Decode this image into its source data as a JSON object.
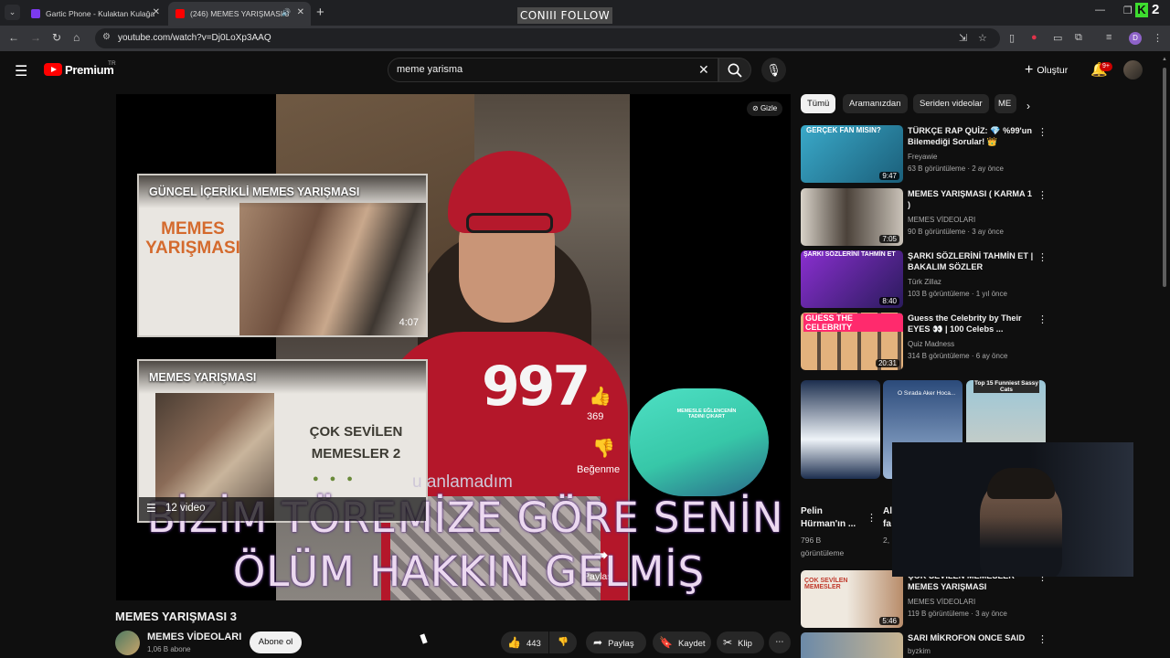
{
  "browser": {
    "tabs": [
      {
        "title": "Gartic Phone - Kulaktan Kulağa",
        "favicon_color": "#7c3aed"
      },
      {
        "title": "(246) MEMES YARIŞMASI 3",
        "favicon_color": "#ff0000"
      }
    ],
    "url": "youtube.com/watch?v=Dj0LoXp3AAQ",
    "profile_initial": "D",
    "icons": {
      "tab_menu": "chevron-down-icon",
      "close": "close-icon",
      "new_tab": "plus-icon",
      "speaker": "speaker-icon",
      "back": "arrow-left-icon",
      "forward": "arrow-right-icon",
      "reload": "reload-icon",
      "home": "home-icon",
      "site_info": "tune-icon",
      "install": "install-app-icon",
      "bookmark_star": "star-icon"
    }
  },
  "stream_overlay": {
    "banner": "CONIII FOLLOW",
    "kick_letter": "K",
    "kick_viewers": "2"
  },
  "youtube": {
    "logo_text": "Premium",
    "country_code": "TR",
    "search_query": "meme yarisma",
    "create_label": "Oluştur",
    "notification_badge": "9+",
    "brand_color": "#ff0000"
  },
  "player": {
    "hide_chip": "Gizle",
    "cards": [
      {
        "title": "GÜNCEL İÇERİKLİ MEMES YARIŞMASI",
        "thumb_text": "MEMES YARIŞMASI",
        "duration": "4:07"
      },
      {
        "title": "MEMES YARIŞMASI",
        "thumb_text": "ÇOK SEVİLEN MEMESLER 2",
        "playlist_count": "12 video"
      }
    ],
    "shirt_number": "997",
    "like_count": "369",
    "dislike_label": "Beğenme",
    "share_label": "Paylaş",
    "promo_text": "MEMESLE EĞLENCENİN TADINI ÇIKART",
    "subtitle_small": "u anlamadım",
    "subtitle_line1": "BİZİM TÖREMİZE GÖRE SENİN",
    "subtitle_line2": "ÖLÜM HAKKIN GELMİŞ"
  },
  "video": {
    "title": "MEMES YARIŞMASI 3",
    "channel": "MEMES VİDEOLARI",
    "subscribers": "1,06 B abone",
    "subscribe_label": "Abone ol",
    "like_count": "443",
    "share_label": "Paylaş",
    "save_label": "Kaydet",
    "clip_label": "Klip"
  },
  "sidebar": {
    "chips": [
      "Tümü",
      "Aramanızdan",
      "Seriden videolar",
      "ME"
    ],
    "recommendations": [
      {
        "title": "TÜRKÇE RAP QUİZ: 💎 %99'un Bilemediği Sorular! 👑",
        "channel": "Freyawie",
        "meta": "63 B görüntüleme · 2 ay önce",
        "duration": "9:47",
        "thumb_text": "GERÇEK FAN MISIN?",
        "thumb_colors": [
          "#3aa9c9",
          "#1b5f7a"
        ]
      },
      {
        "title": "MEMES YARIŞMASI ( KARMA 1 )",
        "channel": "MEMES VİDEOLARI",
        "meta": "90 B görüntüleme · 3 ay önce",
        "duration": "7:05",
        "thumb_text": "",
        "thumb_colors": [
          "#d8d2c8",
          "#4b423a"
        ]
      },
      {
        "title": "ŞARKI SÖZLERİNİ TAHMİN ET | BAKALIM SÖZLER HAFIZAND...",
        "channel": "Türk Zillaz",
        "meta": "103 B görüntüleme · 1 yıl önce",
        "duration": "8:40",
        "thumb_text": "ŞARKI SÖZLERİNİ TAHMİN ET",
        "thumb_colors": [
          "#8a2fd0",
          "#2a1b5c"
        ]
      },
      {
        "title": "Guess the Celebrity by Their EYES 👀 | 100 Celebs ...",
        "channel": "Quiz Madness",
        "meta": "314 B görüntüleme · 6 ay önce",
        "duration": "20:31",
        "thumb_text": "GUESS THE CELEBRITY",
        "thumb_colors": [
          "#e3b27d",
          "#5c4a3c"
        ]
      },
      {
        "title": "ÇOK SEVİLEN MEMESLER MEMES YARIŞMASI",
        "channel": "MEMES VİDEOLARI",
        "meta": "119 B görüntüleme · 3 ay önce",
        "duration": "5:46",
        "thumb_text": "ÇOK SEVİLEN MEMESLER",
        "thumb_colors": [
          "#efe9df",
          "#b88c6a"
        ]
      },
      {
        "title": "SARI MİKROFON ONCE SAID",
        "channel": "byzkim",
        "meta": "",
        "duration": "",
        "thumb_text": "",
        "thumb_colors": [
          "#6c8aa8",
          "#c8b592"
        ]
      }
    ],
    "shorts": [
      {
        "title": "Pelin Hürman'ın ...",
        "meta": "796 B görüntüleme",
        "overlay": "",
        "colors": [
          "#1d2f4f",
          "#eef3f8"
        ]
      },
      {
        "title": "Al fa",
        "meta": "2,",
        "overlay": "O Sırada Aker Hoca...",
        "colors": [
          "#2b4a7a",
          "#9fb8d8"
        ]
      },
      {
        "title": "",
        "meta": "",
        "overlay": "Top 15 Funniest Sassy Cats",
        "colors": [
          "#9bc7d8",
          "#d9cfc0"
        ]
      }
    ]
  }
}
